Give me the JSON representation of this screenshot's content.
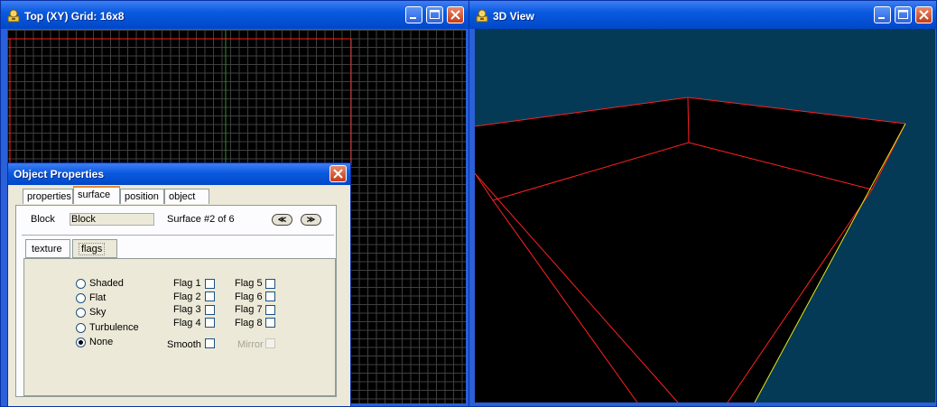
{
  "left_window": {
    "title": "Top (XY) Grid: 16x8"
  },
  "right_window": {
    "title": "3D View"
  },
  "dialog": {
    "title": "Object Properties",
    "tabs": [
      "properties",
      "surface",
      "position",
      "object"
    ],
    "active_tab": "surface",
    "block_label": "Block",
    "block_value": "Block",
    "surface_text": "Surface #2 of 6",
    "prev_glyph": "≪",
    "next_glyph": "≫",
    "subtabs": [
      "texture",
      "flags"
    ],
    "active_subtab": "flags",
    "shading_options": [
      "Shaded",
      "Flat",
      "Sky",
      "Turbulence",
      "None"
    ],
    "selected_shading": "None",
    "flags_col1": [
      "Flag 1",
      "Flag 2",
      "Flag 3",
      "Flag 4"
    ],
    "flags_col2": [
      "Flag 5",
      "Flag 6",
      "Flag 7",
      "Flag 8"
    ],
    "smooth_label": "Smooth",
    "mirror_label": "Mirror"
  },
  "colors": {
    "window_frame": "#2a60d8",
    "grid_bg": "#000000",
    "view3d_bg": "#043a56",
    "edge_red": "#ff2020",
    "edge_yellow": "#e6e61a"
  },
  "icons": [
    "app-icon",
    "minimize-icon",
    "maximize-icon",
    "close-icon",
    "prev-surface-icon",
    "next-surface-icon"
  ]
}
